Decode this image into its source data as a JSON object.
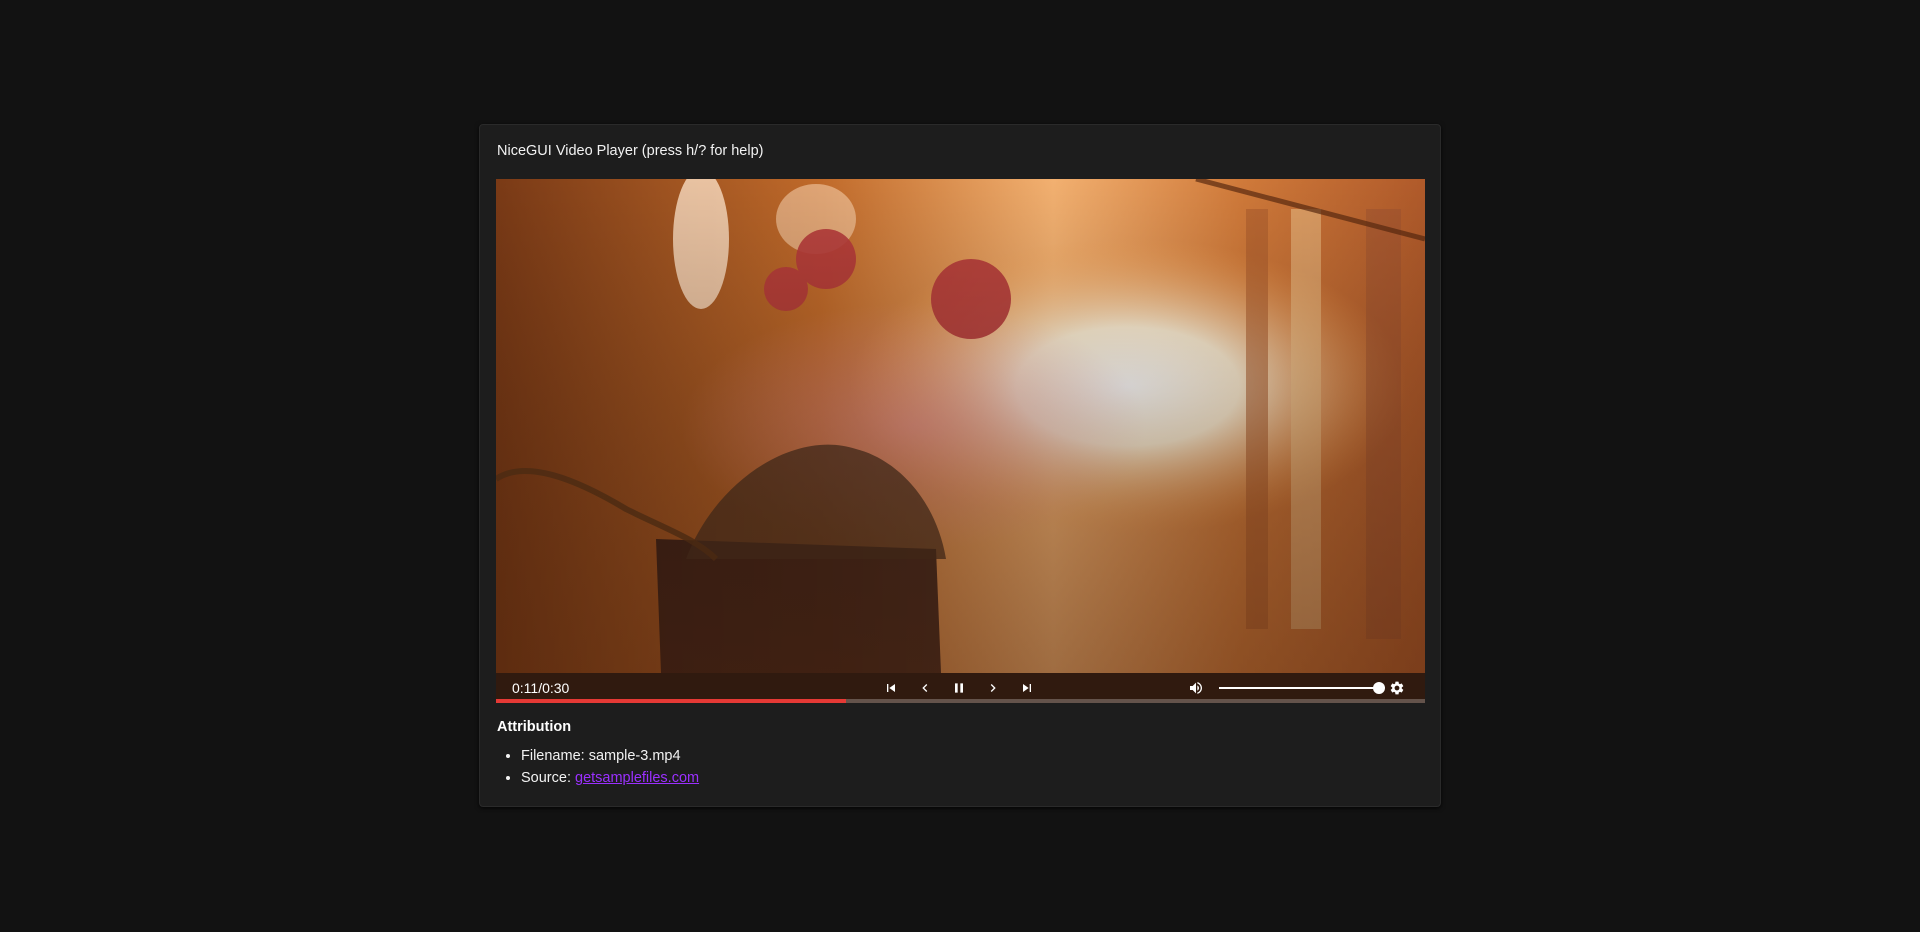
{
  "card": {
    "title": "NiceGUI Video Player (press h/? for help)"
  },
  "player": {
    "time_display": "0:11/0:30",
    "progress": 0.377,
    "volume": 1.0,
    "colors": {
      "progress": "#e53935",
      "controls_icon": "#ffffff"
    },
    "buttons": {
      "skip_previous": "skip-previous-icon",
      "rewind": "chevron-left-icon",
      "pause": "pause-icon",
      "forward": "chevron-right-icon",
      "skip_next": "skip-next-icon",
      "volume": "volume-up-icon",
      "settings": "gear-icon"
    }
  },
  "attribution": {
    "heading": "Attribution",
    "filename_label": "Filename: sample-3.mp4",
    "source_label": "Source: ",
    "source_link_text": "getsamplefiles.com",
    "link_color": "#9b30ff"
  }
}
